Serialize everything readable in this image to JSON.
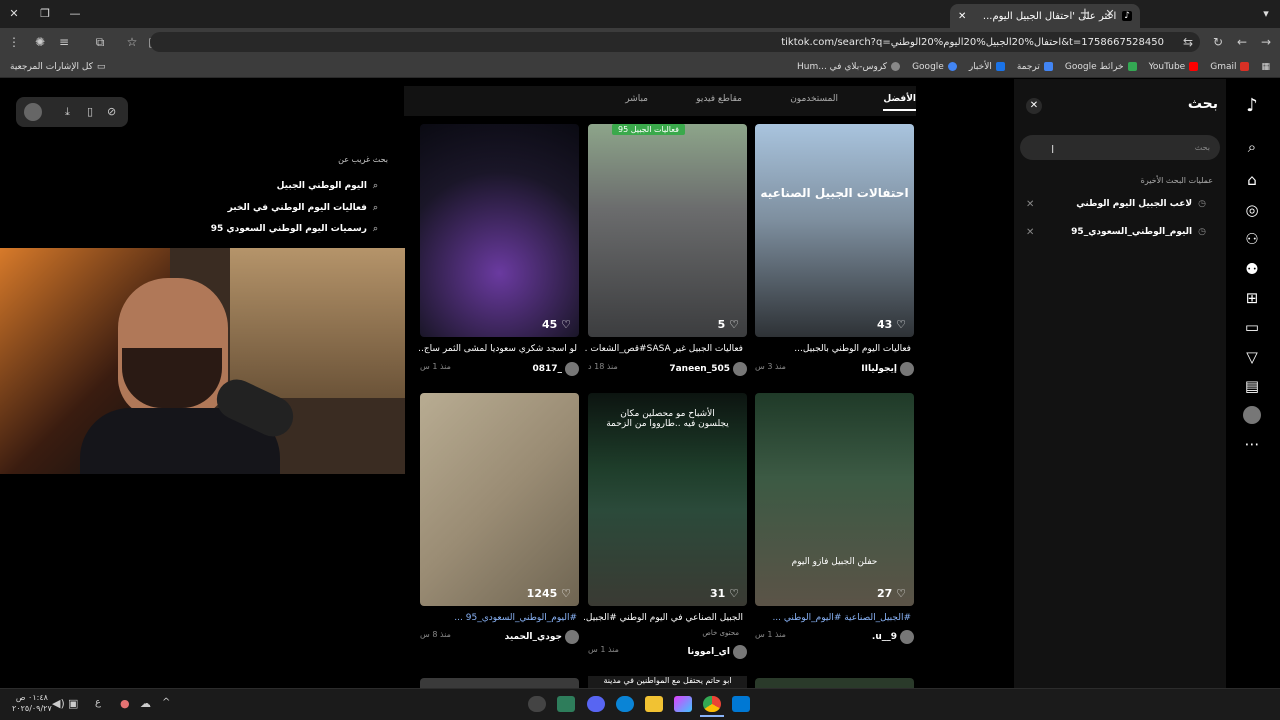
{
  "browser": {
    "tab_title": "اعثر على 'احتفال الجبيل اليوم...",
    "url": "tiktok.com/search?q=احتفال%20الجبيل%20اليوم%20الوطني&t=1758667528450",
    "bookmarks": [
      {
        "label": "Gmail",
        "color": "#d93025"
      },
      {
        "label": "YouTube",
        "color": "#ff0000"
      },
      {
        "label": "خرائط Google",
        "color": "#34a853"
      },
      {
        "label": "ترجمة",
        "color": "#4285f4"
      },
      {
        "label": "الأخبار",
        "color": "#1a73e8"
      },
      {
        "label": "Google",
        "color": "#4285f4"
      },
      {
        "label": "كروس-بلاي في ...Hum",
        "color": "#888888"
      }
    ],
    "all_bookmarks": "كل الإشارات المرجعية"
  },
  "sidebar": {
    "search_title": "بحث",
    "search_placeholder": "بحث",
    "recent_title": "عمليات البحث الأخيرة",
    "recent": [
      "لاعب الجبيل اليوم الوطني",
      "اليوم_الوطني_السعودي_95"
    ]
  },
  "tabs": [
    "الأفضل",
    "المستخدمون",
    "مقاطع فيديو",
    "مباشر"
  ],
  "suggestions": {
    "title": "بحث غريب عن",
    "items": [
      "اليوم الوطني الجبيل",
      "فعاليات اليوم الوطني في الخبر",
      "رسميات اليوم الوطني السعودي 95"
    ]
  },
  "videos": [
    {
      "likes": "43",
      "caption": "فعاليات اليوم الوطني بالجبيل...",
      "user": "إيجولياII",
      "time": "منذ 3 س",
      "overlay": "احتفالات الجبيل الصناعيه",
      "bg": "#5c6f86"
    },
    {
      "likes": "5",
      "caption": "فعاليات الجبيل غير SASA#قص_الشعات ...",
      "user": "7aneen_505",
      "time": "منذ 18 د",
      "overlay": "فعاليات الجبيل 95",
      "bg": "#6b6c6d"
    },
    {
      "likes": "45",
      "caption": "لو أسجد شكري سعودياً لمشى الثمر ساج...",
      "user": "_0817",
      "time": "منذ 1 س",
      "overlay": "",
      "bg": "#1a1628"
    },
    {
      "likes": "27",
      "caption": "#الجبيل_الصناعية #اليوم_الوطني ...",
      "user": "9__u.",
      "time": "منذ 1 س",
      "overlay": "حفلن الجبيل فازو اليوم",
      "bg": "#2c4a33"
    },
    {
      "likes": "31",
      "caption": "الجبيل الصناعي في اليوم الوطني #الجبيل...",
      "user": "اي_اموونا",
      "time": "منذ 1 س",
      "overlay": "الأشباح مو محصلين مكان يجلسون فيه ..طارووا من الزحمة",
      "bg": "#1e2a26",
      "sub": "محتوى خاص"
    },
    {
      "likes": "1245",
      "caption": "#اليوم_الوطني_السعودي_95 ...",
      "user": "جودي_الحميد",
      "time": "منذ 8 س",
      "overlay": "",
      "bg": "#9a8c74"
    }
  ],
  "partial_caption": "ابو حاتم يحتفل مع المواطنين في مدينة",
  "clock": {
    "time": "٠١:٤٨ ص",
    "date": "٢٠٢٥/٠٩/٢٧"
  }
}
